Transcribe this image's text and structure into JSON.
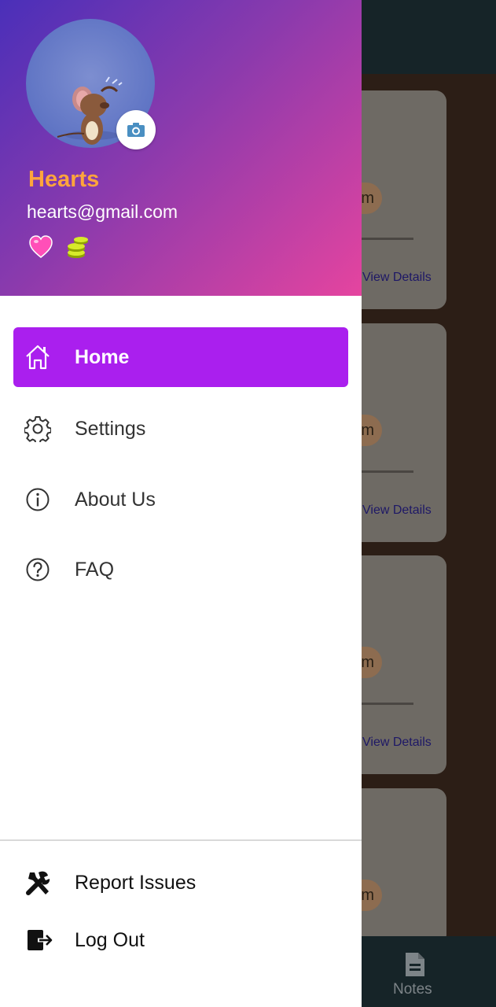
{
  "user": {
    "name": "Hearts",
    "email": "hearts@gmail.com"
  },
  "menu": {
    "items": [
      {
        "label": "Home",
        "icon": "home-icon",
        "active": true
      },
      {
        "label": "Settings",
        "icon": "gear-icon",
        "active": false
      },
      {
        "label": "About Us",
        "icon": "info-icon",
        "active": false
      },
      {
        "label": "FAQ",
        "icon": "help-icon",
        "active": false
      }
    ]
  },
  "footer": {
    "report_label": "Report Issues",
    "logout_label": "Log Out"
  },
  "background": {
    "card_avatar_text": "m",
    "card_link": "View Details",
    "nav_notes_label": "Notes"
  },
  "colors": {
    "accent": "#aa1fee",
    "name": "#ffa53c",
    "header_gradient": [
      "#4a2fb9",
      "#e5449f"
    ]
  }
}
